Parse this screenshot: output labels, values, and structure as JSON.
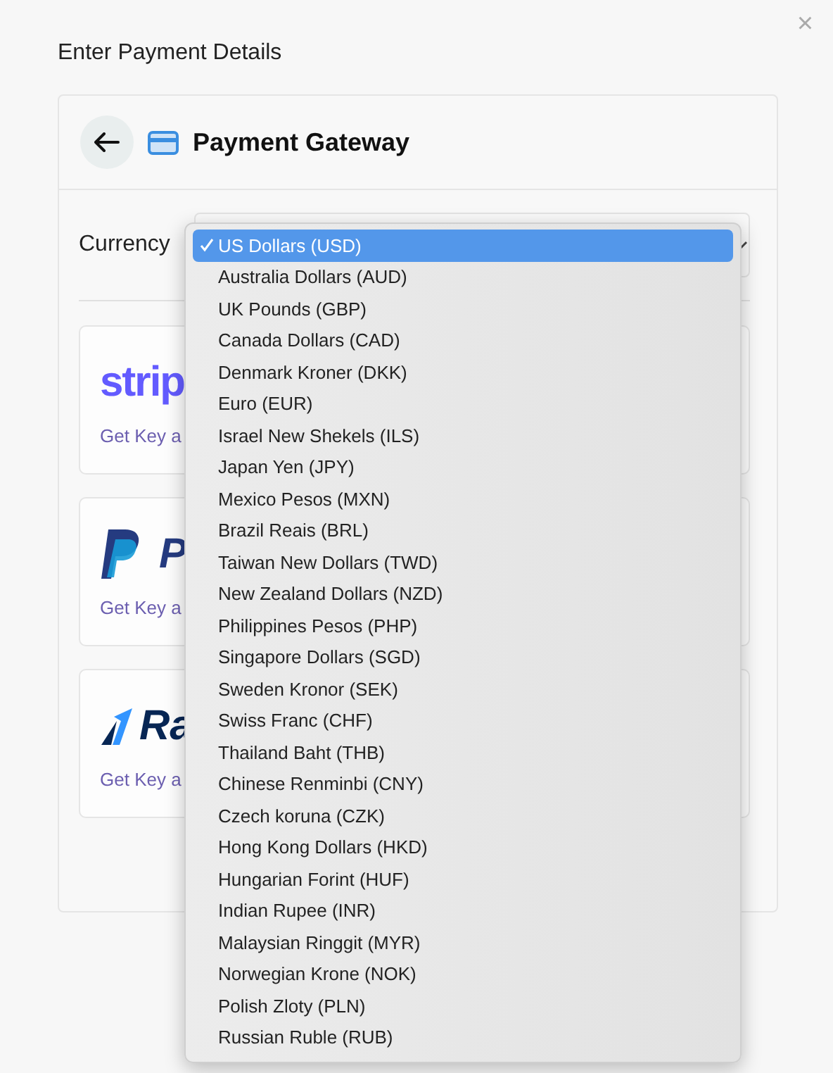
{
  "dialog": {
    "title": "Enter Payment Details",
    "close": "×"
  },
  "panel": {
    "title": "Payment Gateway"
  },
  "currency": {
    "label": "Currency",
    "options": [
      {
        "label": "US Dollars (USD)",
        "selected": true
      },
      {
        "label": "Australia Dollars (AUD)",
        "selected": false
      },
      {
        "label": "UK Pounds (GBP)",
        "selected": false
      },
      {
        "label": "Canada Dollars (CAD)",
        "selected": false
      },
      {
        "label": "Denmark Kroner (DKK)",
        "selected": false
      },
      {
        "label": "Euro (EUR)",
        "selected": false
      },
      {
        "label": "Israel New Shekels (ILS)",
        "selected": false
      },
      {
        "label": "Japan Yen (JPY)",
        "selected": false
      },
      {
        "label": "Mexico Pesos (MXN)",
        "selected": false
      },
      {
        "label": "Brazil Reais (BRL)",
        "selected": false
      },
      {
        "label": "Taiwan New Dollars (TWD)",
        "selected": false
      },
      {
        "label": "New Zealand Dollars (NZD)",
        "selected": false
      },
      {
        "label": "Philippines Pesos (PHP)",
        "selected": false
      },
      {
        "label": "Singapore Dollars (SGD)",
        "selected": false
      },
      {
        "label": "Sweden Kronor (SEK)",
        "selected": false
      },
      {
        "label": "Swiss Franc (CHF)",
        "selected": false
      },
      {
        "label": "Thailand Baht (THB)",
        "selected": false
      },
      {
        "label": "Chinese Renminbi (CNY)",
        "selected": false
      },
      {
        "label": "Czech koruna (CZK)",
        "selected": false
      },
      {
        "label": "Hong Kong Dollars (HKD)",
        "selected": false
      },
      {
        "label": "Hungarian Forint (HUF)",
        "selected": false
      },
      {
        "label": "Indian Rupee (INR)",
        "selected": false
      },
      {
        "label": "Malaysian Ringgit (MYR)",
        "selected": false
      },
      {
        "label": "Norwegian Krone (NOK)",
        "selected": false
      },
      {
        "label": "Polish Zloty (PLN)",
        "selected": false
      },
      {
        "label": "Russian Ruble (RUB)",
        "selected": false
      }
    ]
  },
  "gateways": [
    {
      "kind": "stripe",
      "logo_text": "strip",
      "link": "Get Key a"
    },
    {
      "kind": "paypal",
      "logo_text": "P",
      "link": "Get Key a"
    },
    {
      "kind": "razorpay",
      "logo_text": "Ra",
      "link": "Get Key a"
    }
  ]
}
